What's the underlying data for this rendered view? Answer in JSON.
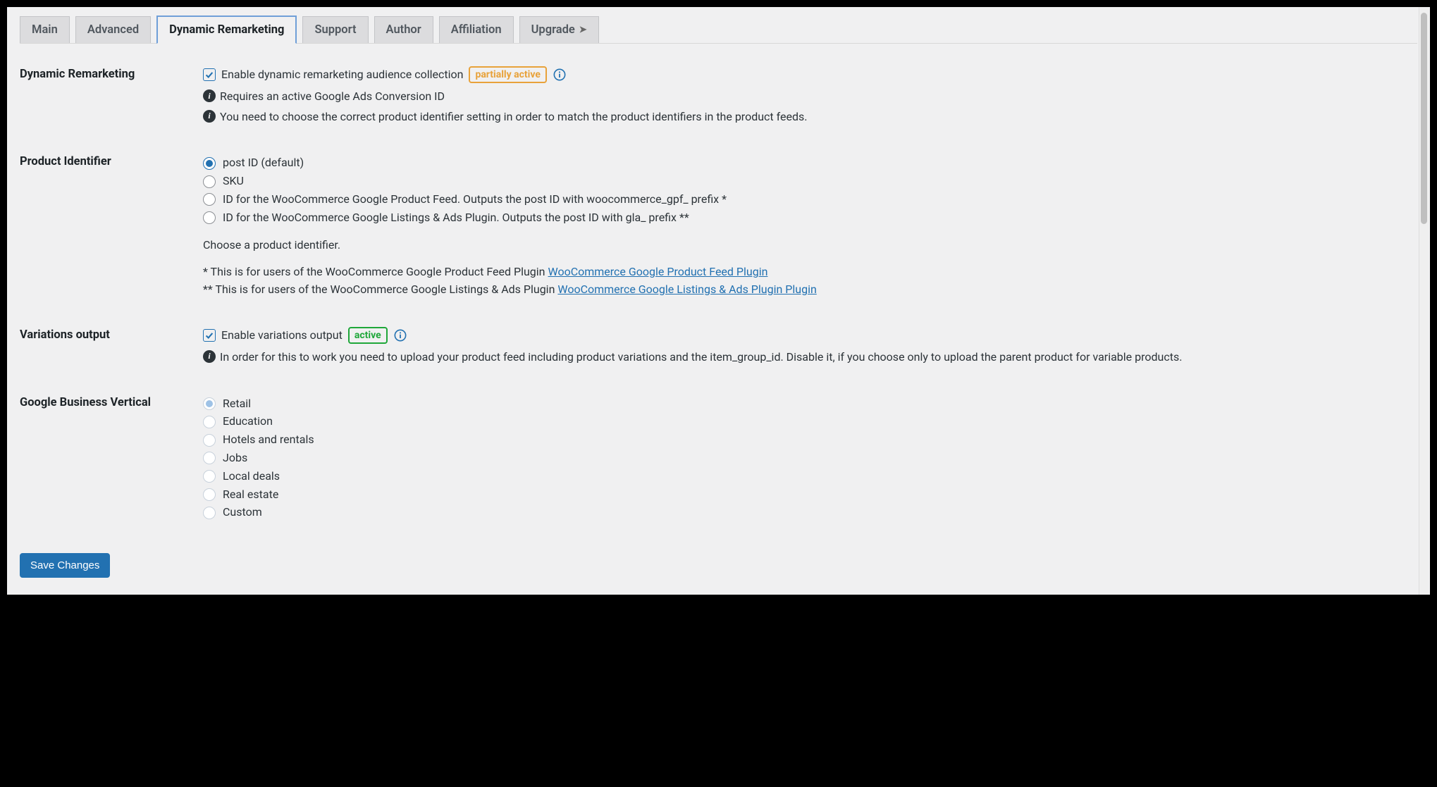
{
  "tabs": {
    "main": "Main",
    "advanced": "Advanced",
    "dynamic_remarketing": "Dynamic Remarketing",
    "support": "Support",
    "author": "Author",
    "affiliation": "Affiliation",
    "upgrade": "Upgrade"
  },
  "sections": {
    "dynamic_remarketing": {
      "label": "Dynamic Remarketing",
      "checkbox_label": "Enable dynamic remarketing audience collection",
      "badge": "partially active",
      "note1": "Requires an active Google Ads Conversion ID",
      "note2": "You need to choose the correct product identifier setting in order to match the product identifiers in the product feeds."
    },
    "product_identifier": {
      "label": "Product Identifier",
      "options": {
        "post_id": "post ID (default)",
        "sku": "SKU",
        "gpf": "ID for the WooCommerce Google Product Feed. Outputs the post ID with woocommerce_gpf_ prefix *",
        "gla": "ID for the WooCommerce Google Listings & Ads Plugin. Outputs the post ID with gla_ prefix **"
      },
      "help": "Choose a product identifier.",
      "footnote1_prefix": "* This is for users of the WooCommerce Google Product Feed Plugin ",
      "footnote1_link": "WooCommerce Google Product Feed Plugin",
      "footnote2_prefix": "** This is for users of the WooCommerce Google Listings & Ads Plugin ",
      "footnote2_link": "WooCommerce Google Listings & Ads Plugin Plugin"
    },
    "variations_output": {
      "label": "Variations output",
      "checkbox_label": "Enable variations output",
      "badge": "active",
      "note": "In order for this to work you need to upload your product feed including product variations and the item_group_id. Disable it, if you choose only to upload the parent product for variable products."
    },
    "google_business_vertical": {
      "label": "Google Business Vertical",
      "options": {
        "retail": "Retail",
        "education": "Education",
        "hotels": "Hotels and rentals",
        "jobs": "Jobs",
        "local_deals": "Local deals",
        "real_estate": "Real estate",
        "custom": "Custom"
      }
    }
  },
  "buttons": {
    "save": "Save Changes"
  }
}
